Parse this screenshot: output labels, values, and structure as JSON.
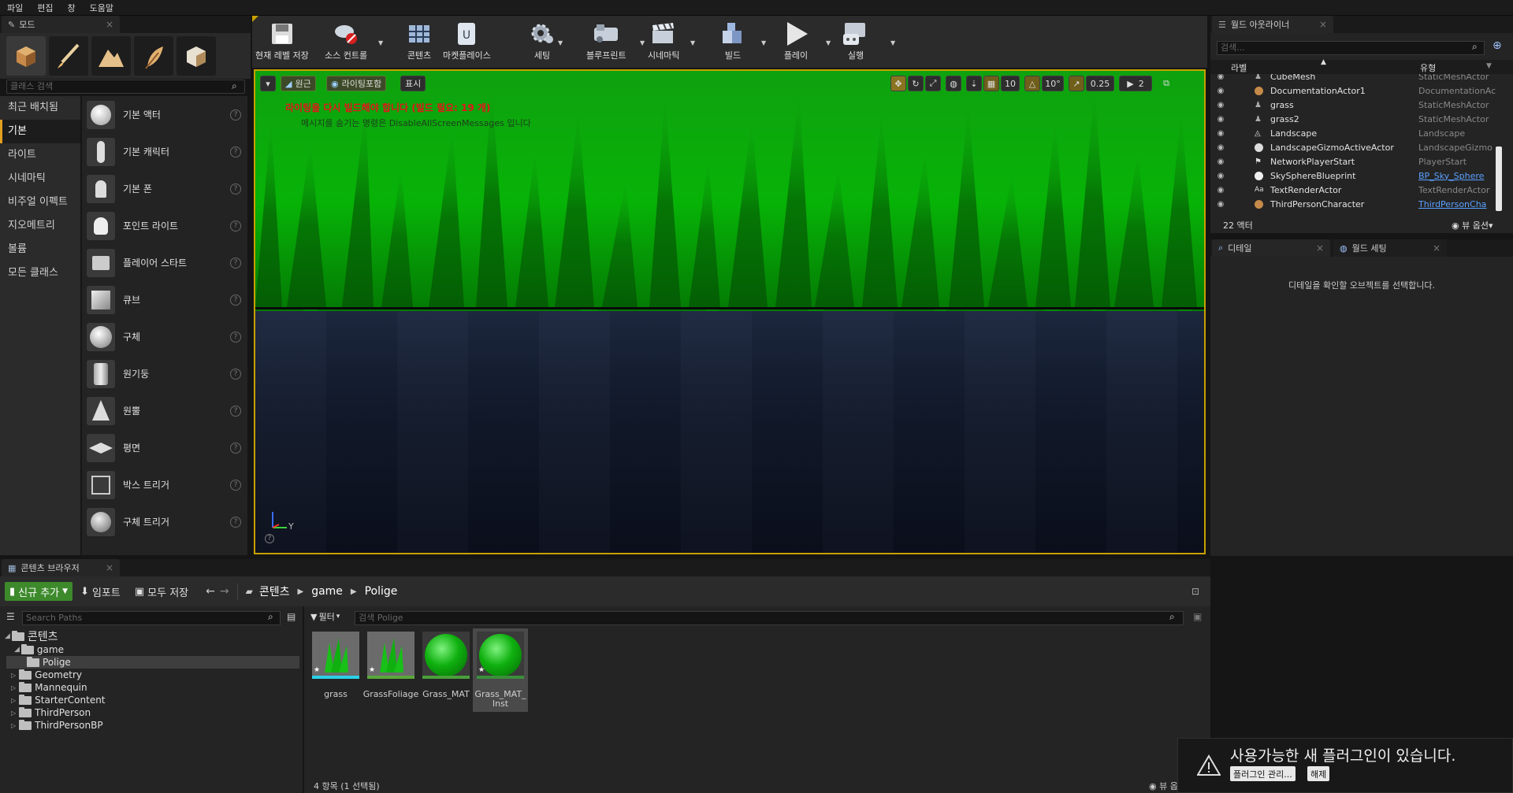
{
  "menu": [
    "파일",
    "편집",
    "창",
    "도움말"
  ],
  "modes": {
    "tab": "모드",
    "search_placeholder": "클래스 검색",
    "categories": [
      "최근 배치됨",
      "기본",
      "라이트",
      "시네마틱",
      "비주얼 이펙트",
      "지오메트리",
      "볼륨",
      "모든 클래스"
    ],
    "items": [
      "기본 액터",
      "기본 캐릭터",
      "기본 폰",
      "포인트 라이트",
      "플레이어 스타트",
      "큐브",
      "구체",
      "원기둥",
      "원뿔",
      "평면",
      "박스 트리거",
      "구체 트리거"
    ],
    "help": "?"
  },
  "toolbar": {
    "save": "현재 레벨 저장",
    "source": "소스 컨트롤",
    "content": "콘텐츠",
    "market": "마켓플레이스",
    "settings": "세팅",
    "blueprint": "블루프린트",
    "cinematic": "시네마틱",
    "build": "빌드",
    "play": "플레이",
    "launch": "실행"
  },
  "viewport": {
    "perspective": "원근",
    "lit": "라이팅포함",
    "show": "표시",
    "warning": "라이팅을 다시 빌드해야 합니다 (빌드 필요: 19 개)",
    "hide_msg": "메시지를 숨기는 명령은 DisableAllScreenMessages 입니다",
    "grid": "10",
    "rot": "10°",
    "scale": "0.25",
    "camspeed": "2",
    "axis_y": "Y"
  },
  "outliner": {
    "tab": "월드 아웃라이너",
    "search_placeholder": "검색...",
    "col_label": "라벨",
    "col_type": "유형",
    "rows": [
      {
        "name": "CubeMesh",
        "type": "StaticMeshActor",
        "link": false
      },
      {
        "name": "DocumentationActor1",
        "type": "DocumentationAc",
        "link": false
      },
      {
        "name": "grass",
        "type": "StaticMeshActor",
        "link": false
      },
      {
        "name": "grass2",
        "type": "StaticMeshActor",
        "link": false
      },
      {
        "name": "Landscape",
        "type": "Landscape",
        "link": false
      },
      {
        "name": "LandscapeGizmoActiveActor",
        "type": "LandscapeGizmo",
        "link": false
      },
      {
        "name": "NetworkPlayerStart",
        "type": "PlayerStart",
        "link": false
      },
      {
        "name": "SkySphereBlueprint",
        "type": "BP_Sky_Sphere",
        "link": true
      },
      {
        "name": "TextRenderActor",
        "type": "TextRenderActor",
        "link": false
      },
      {
        "name": "ThirdPersonCharacter",
        "type": "ThirdPersonCha",
        "link": true
      }
    ],
    "count": "22 액터",
    "view_options": "뷰 옵션"
  },
  "details": {
    "tab1": "디테일",
    "tab2": "월드 세팅",
    "empty": "디테일을 확인할 오브젝트를 선택합니다."
  },
  "content_browser": {
    "tab": "콘텐츠 브라우저",
    "add_new": "신규 추가",
    "import": "임포트",
    "save_all": "모두 저장",
    "path": [
      "콘텐츠",
      "game",
      "Polige"
    ],
    "search_paths": "Search Paths",
    "filter": "필터",
    "search_assets": "검색 Polige",
    "tree_root": "콘텐츠",
    "tree_game": "game",
    "tree_polige": "Polige",
    "tree_others": [
      "Geometry",
      "Mannequin",
      "StarterContent",
      "ThirdPerson",
      "ThirdPersonBP"
    ],
    "assets": [
      "grass",
      "GrassFoliage",
      "Grass_MAT",
      "Grass_MAT_\nInst"
    ],
    "status": "4 항목 (1 선택됨)",
    "view_options": "뷰 옵션"
  },
  "notification": {
    "title": "사용가능한 새 플러그인이 있습니다.",
    "manage": "플러그인 관리...",
    "dismiss": "해제"
  }
}
